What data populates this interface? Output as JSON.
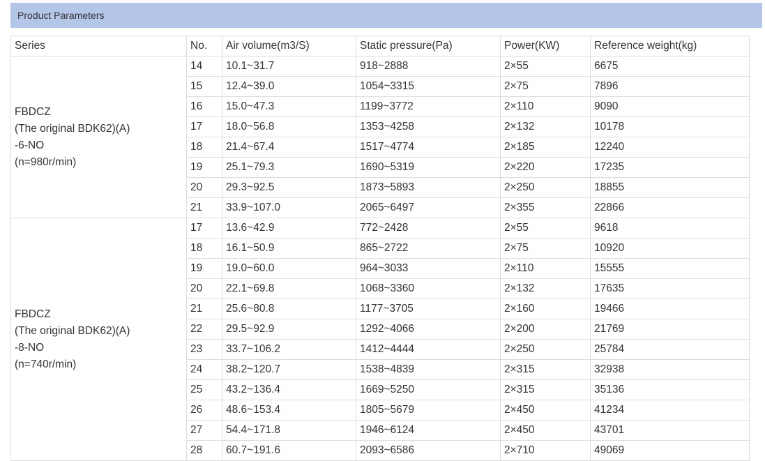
{
  "section": {
    "title": "Product Parameters"
  },
  "table": {
    "headers": [
      "Series",
      "No.",
      "Air volume(m3/S)",
      "Static pressure(Pa)",
      "Power(KW)",
      "Reference weight(kg)"
    ],
    "groups": [
      {
        "series_lines": [
          "FBDCZ",
          "(The original BDK62)(A)",
          "-6-NO",
          "(n=980r/min)"
        ],
        "rows": [
          [
            "14",
            "10.1~31.7",
            "918~2888",
            "2×55",
            "6675"
          ],
          [
            "15",
            "12.4~39.0",
            "1054~3315",
            "2×75",
            "7896"
          ],
          [
            "16",
            "15.0~47.3",
            "1199~3772",
            "2×110",
            "9090"
          ],
          [
            "17",
            "18.0~56.8",
            "1353~4258",
            "2×132",
            "10178"
          ],
          [
            "18",
            "21.4~67.4",
            "1517~4774",
            "2×185",
            "12240"
          ],
          [
            "19",
            "25.1~79.3",
            "1690~5319",
            "2×220",
            "17235"
          ],
          [
            "20",
            "29.3~92.5",
            "1873~5893",
            "2×250",
            "18855"
          ],
          [
            "21",
            "33.9~107.0",
            "2065~6497",
            "2×355",
            "22866"
          ]
        ]
      },
      {
        "series_lines": [
          "FBDCZ",
          "(The original BDK62)(A)",
          "-8-NO",
          "(n=740r/min)"
        ],
        "rows": [
          [
            "17",
            "13.6~42.9",
            "772~2428",
            "2×55",
            "9618"
          ],
          [
            "18",
            "16.1~50.9",
            "865~2722",
            "2×75",
            "10920"
          ],
          [
            "19",
            "19.0~60.0",
            "964~3033",
            "2×110",
            "15555"
          ],
          [
            "20",
            "22.1~69.8",
            "1068~3360",
            "2×132",
            "17635"
          ],
          [
            "21",
            "25.6~80.8",
            "1177~3705",
            "2×160",
            "19466"
          ],
          [
            "22",
            "29.5~92.9",
            "1292~4066",
            "2×200",
            "21769"
          ],
          [
            "23",
            "33.7~106.2",
            "1412~4444",
            "2×250",
            "25784"
          ],
          [
            "24",
            "38.2~120.7",
            "1538~4839",
            "2×315",
            "32938"
          ],
          [
            "25",
            "43.2~136.4",
            "1669~5250",
            "2×315",
            "35136"
          ],
          [
            "26",
            "48.6~153.4",
            "1805~5679",
            "2×450",
            "41234"
          ],
          [
            "27",
            "54.4~171.8",
            "1946~6124",
            "2×450",
            "43701"
          ],
          [
            "28",
            "60.7~191.6",
            "2093~6586",
            "2×710",
            "49069"
          ]
        ]
      }
    ]
  }
}
